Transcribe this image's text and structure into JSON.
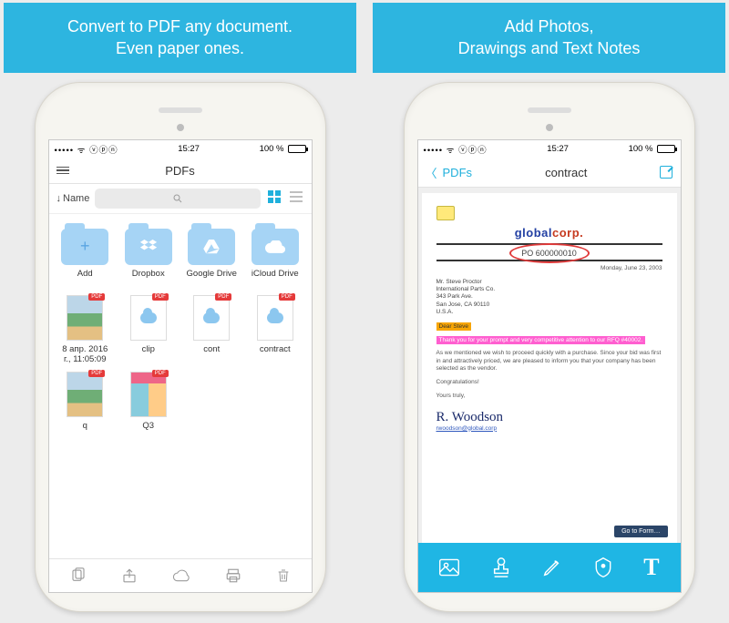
{
  "panels": {
    "left": {
      "caption": "Convert to PDF any document.\nEven paper ones.",
      "status": {
        "carrier_indicator": "••••• ᯤ ⓥⓟⓝ",
        "time": "15:27",
        "battery": "100 %"
      },
      "nav": {
        "title": "PDFs"
      },
      "toolbar": {
        "sort_label": "Name",
        "search_placeholder": ""
      },
      "folders": [
        {
          "name": "Add",
          "icon": "plus"
        },
        {
          "name": "Dropbox",
          "icon": "dropbox"
        },
        {
          "name": "Google Drive",
          "icon": "drive"
        },
        {
          "name": "iCloud Drive",
          "icon": "cloud"
        }
      ],
      "files": [
        {
          "name": "8 апр. 2016\nг., 11:05:09",
          "kind": "photo",
          "pdf": true
        },
        {
          "name": "clip",
          "kind": "cloud",
          "pdf": true
        },
        {
          "name": "cont",
          "kind": "cloud",
          "pdf": true
        },
        {
          "name": "contract",
          "kind": "cloud",
          "pdf": true
        },
        {
          "name": "q",
          "kind": "photo",
          "pdf": true
        },
        {
          "name": "Q3",
          "kind": "collage",
          "pdf": true
        }
      ]
    },
    "right": {
      "caption": "Add Photos,\nDrawings and Text Notes",
      "status": {
        "carrier_indicator": "••••• ᯤ ⓥⓟⓝ",
        "time": "15:27",
        "battery": "100 %"
      },
      "nav": {
        "back": "PDFs",
        "title": "contract"
      },
      "document": {
        "company": {
          "part1": "global",
          "part2": "corp",
          "dot": "."
        },
        "po": "PO 600000010",
        "date": "Monday, June 23, 2003",
        "address": "Mr. Steve Proctor\nInternational Parts Co.\n343 Park Ave.\nSan Jose, CA 90110\nU.S.A.",
        "hilite1": "Dear Steve",
        "hilite2": "Thank you for your prompt and very competitive attention to our RFQ #40002.",
        "body": "As we mentioned we wish to proceed quickly with a purchase. Since your bid was first in and attractively priced, we are pleased to inform you that your company has been selected as the vendor.",
        "congrats": "Congratulations!",
        "closing": "Yours truly,",
        "signature": "R. Woodson",
        "link": "rwoodson@global.corp",
        "goto": "Go to Form…"
      }
    }
  }
}
